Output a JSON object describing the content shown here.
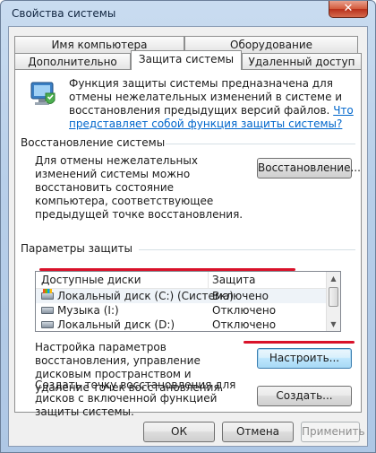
{
  "window": {
    "title": "Свойства системы",
    "close_glyph": "✕"
  },
  "tabs": {
    "row1": [
      "Имя компьютера",
      "Оборудование"
    ],
    "row2": [
      "Дополнительно",
      "Защита системы",
      "Удаленный доступ"
    ],
    "active": "Защита системы"
  },
  "intro": {
    "text": "Функция защиты системы предназначена для отмены нежелательных изменений в системе и восстановления предыдущих версий файлов.",
    "link": "Что представляет собой функция защиты системы?"
  },
  "restore": {
    "group_title": "Восстановление системы",
    "description": "Для отмены нежелательных изменений системы можно восстановить состояние компьютера, соответствующее предыдущей точке восстановления.",
    "button": "Восстановление..."
  },
  "protection": {
    "group_title": "Параметры защиты",
    "columns": [
      "Доступные диски",
      "Защита"
    ],
    "rows": [
      {
        "name": "Локальный диск (C:) (Система)",
        "status": "Включено",
        "icon": "system-drive-icon"
      },
      {
        "name": "Музыка (I:)",
        "status": "Отключено",
        "icon": "drive-icon"
      },
      {
        "name": "Локальный диск (D:)",
        "status": "Отключено",
        "icon": "drive-icon"
      }
    ],
    "configure_text": "Настройка параметров восстановления, управление дисковым пространством и удаление точек восстановления.",
    "configure_button": "Настроить...",
    "create_text": "Создать точку восстановления для дисков с включенной функцией защиты системы.",
    "create_button": "Создать..."
  },
  "footer": {
    "ok": "ОК",
    "cancel": "Отмена",
    "apply": "Применить"
  },
  "annotation_color": "#d9122a"
}
